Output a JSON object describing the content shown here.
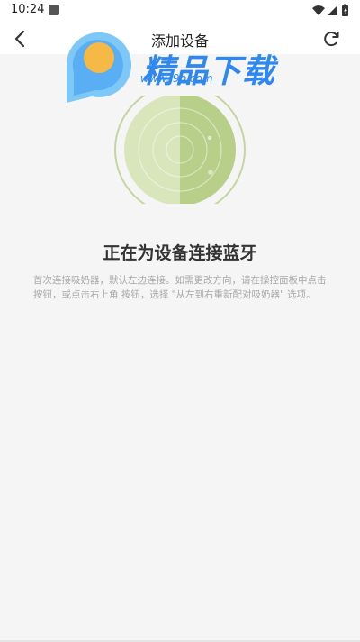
{
  "status_bar": {
    "time": "10:24"
  },
  "app_bar": {
    "title": "添加设备",
    "back_icon": "arrow-left-icon",
    "refresh_icon": "refresh-icon"
  },
  "watermark": {
    "brand": "精品下载",
    "url": "www.j9p.com"
  },
  "main": {
    "scan_title": "正在为设备连接蓝牙",
    "instructions": "首次连接吸奶器，默认左边连接。如需更改方向，请在操控面板中点击 按钮，或点击右上角 按钮，选择 \"从左到右重新配对吸奶器\" 选项。"
  },
  "colors": {
    "radar_green": "#b8cf8a",
    "watermark_blue": "#2e88f0",
    "watermark_orange": "#f6b945"
  }
}
